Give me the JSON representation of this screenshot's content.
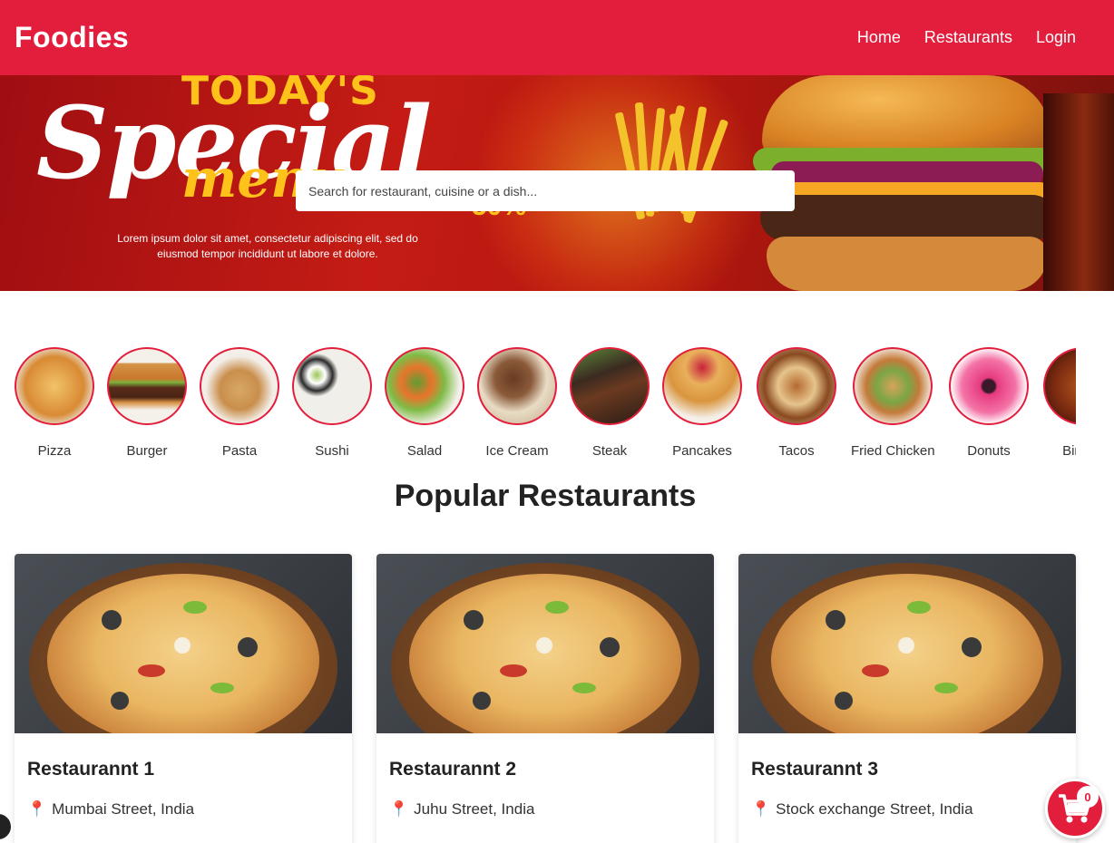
{
  "navbar": {
    "logo": "Foodies",
    "links": [
      "Home",
      "Restaurants",
      "Login"
    ]
  },
  "hero": {
    "title_top": "TODAY'S",
    "title_script": "Special",
    "title_menu": "menu",
    "discount": "50%",
    "lorem": "Lorem ipsum dolor sit amet, consectetur adipiscing elit, sed do eiusmod tempor incididunt ut labore et dolore."
  },
  "search": {
    "placeholder": "Search for restaurant, cuisine or a dish..."
  },
  "categories": [
    {
      "label": "Pizza",
      "icon": "pizza-image"
    },
    {
      "label": "Burger",
      "icon": "burger-image"
    },
    {
      "label": "Pasta",
      "icon": "pasta-image"
    },
    {
      "label": "Sushi",
      "icon": "sushi-image"
    },
    {
      "label": "Salad",
      "icon": "salad-image"
    },
    {
      "label": "Ice Cream",
      "icon": "ice-cream-image"
    },
    {
      "label": "Steak",
      "icon": "steak-image"
    },
    {
      "label": "Pancakes",
      "icon": "pancakes-image"
    },
    {
      "label": "Tacos",
      "icon": "tacos-image"
    },
    {
      "label": "Fried Chicken",
      "icon": "fried-chicken-image"
    },
    {
      "label": "Donuts",
      "icon": "donuts-image"
    },
    {
      "label": "Biryani",
      "icon": "biryani-image"
    }
  ],
  "section": {
    "heading": "Popular Restaurants"
  },
  "restaurants": [
    {
      "name": "Restaurannt 1",
      "location": "Mumbai Street, India"
    },
    {
      "name": "Restaurannt 2",
      "location": "Juhu Street, India"
    },
    {
      "name": "Restaurannt 3",
      "location": "Stock exchange Street, India"
    }
  ],
  "cart": {
    "count": "0"
  },
  "colors": {
    "brand": "#e31e3c",
    "text": "#222222"
  }
}
